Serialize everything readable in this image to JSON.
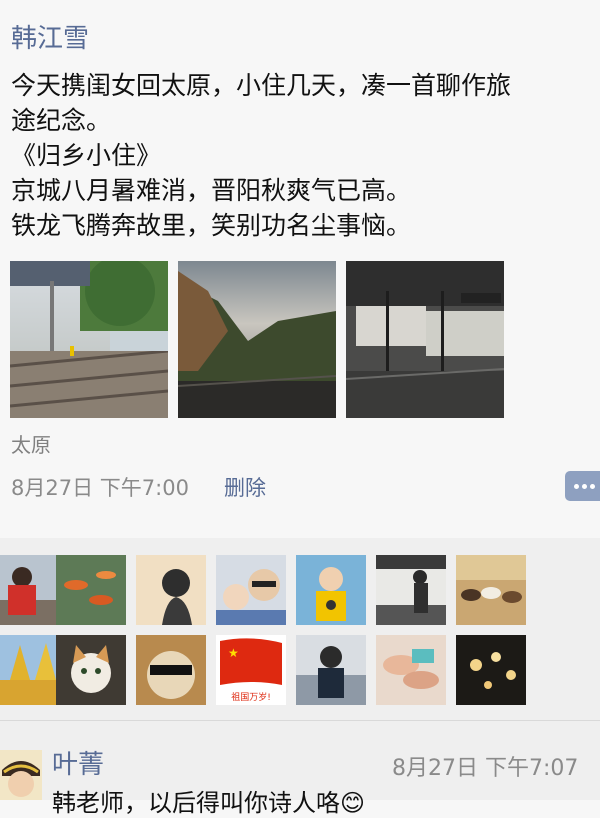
{
  "post": {
    "author": "韩江雪",
    "text": "今天携闺女回太原，小住几天，凑一首聊作旅\n途纪念。\n《归乡小住》\n京城八月暑难消，晋阳秋爽气已高。\n铁龙飞腾奔故里，笑别功名尘事恼。",
    "photos": [
      "photo-station",
      "photo-train-window",
      "photo-platform"
    ],
    "location": "太原",
    "date": "8月27日",
    "time": "下午7:00",
    "delete_label": "删除",
    "more_icon": "comment-more-icon"
  },
  "likes": {
    "avatars": [
      "avatar-girl-red",
      "avatar-goldfish",
      "avatar-silhouette",
      "avatar-father-baby",
      "avatar-kid-yellow",
      "avatar-window-man",
      "avatar-horses",
      "avatar-autumn-trees",
      "avatar-cat",
      "avatar-cool-cat",
      "avatar-flag",
      "avatar-man-water",
      "avatar-hands",
      "avatar-lights"
    ],
    "flag_caption": "祖国万岁!"
  },
  "comment": {
    "name": "叶菁",
    "date": "8月27日",
    "time": "下午7:07",
    "text": "韩老师，以后得叫你诗人咯😊"
  }
}
